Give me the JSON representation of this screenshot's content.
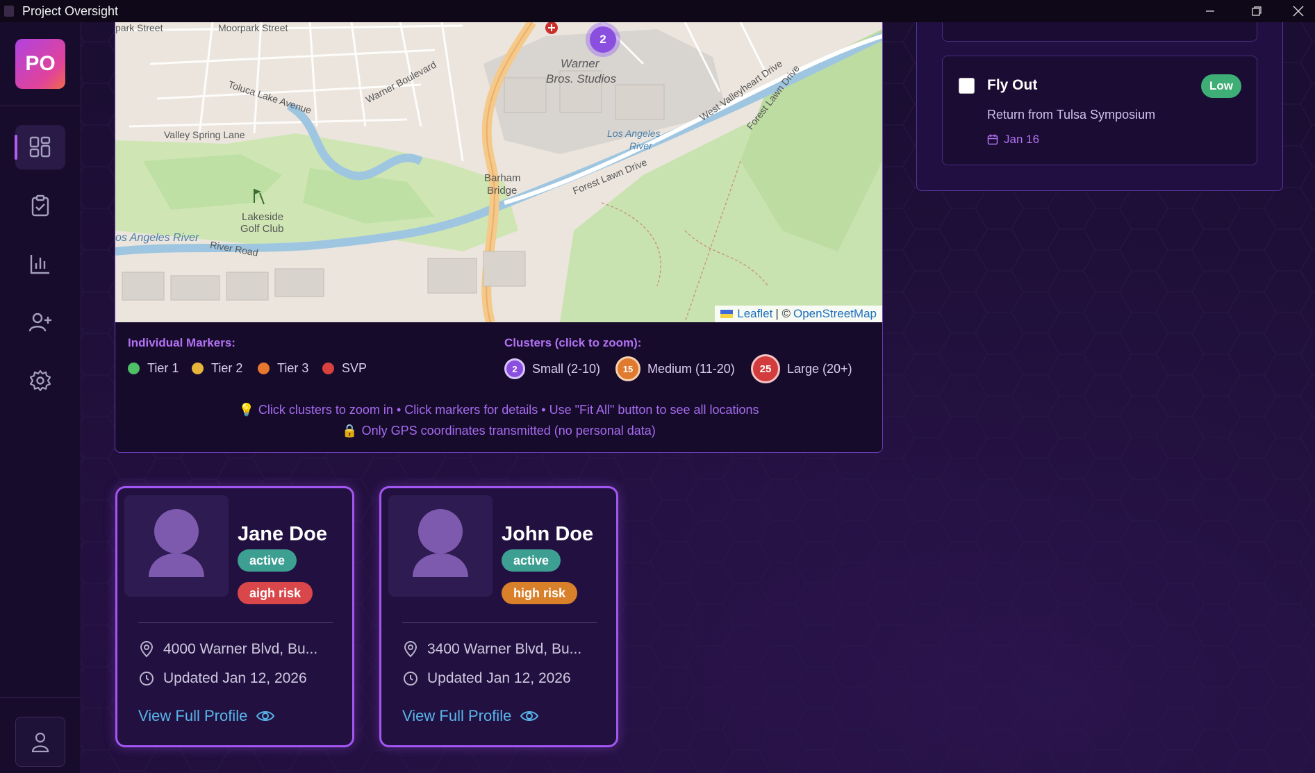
{
  "window": {
    "title": "Project Oversight",
    "controls": [
      "minimize",
      "restore",
      "close"
    ]
  },
  "sidebar": {
    "logo_text": "PO",
    "nav": [
      {
        "name": "dashboard",
        "icon": "dashboard-icon",
        "active": true
      },
      {
        "name": "tasks",
        "icon": "clipboard-check-icon",
        "active": false
      },
      {
        "name": "analytics",
        "icon": "bar-chart-icon",
        "active": false
      },
      {
        "name": "add-user",
        "icon": "user-plus-icon",
        "active": false
      },
      {
        "name": "settings",
        "icon": "gear-icon",
        "active": false
      }
    ],
    "profile_icon": "user-icon"
  },
  "map": {
    "labels": [
      {
        "text": "park Street"
      },
      {
        "text": "Moorpark Street"
      },
      {
        "text": "Toluca Lake Avenue"
      },
      {
        "text": "Warner Boulevard"
      },
      {
        "text": "Warner"
      },
      {
        "text": "Bros. Studios"
      },
      {
        "text": "Valley Spring Lane"
      },
      {
        "text": "Barham"
      },
      {
        "text": "Bridge"
      },
      {
        "text": "Lakeside"
      },
      {
        "text": "Golf Club"
      },
      {
        "text": "os Angeles River"
      },
      {
        "text": "River Road"
      },
      {
        "text": "Forest Lawn Drive"
      },
      {
        "text": "Los Angeles"
      },
      {
        "text": "River"
      },
      {
        "text": "West Valleyheart Drive"
      },
      {
        "text": "Forest Lawn Drive"
      }
    ],
    "cluster_marker": "2",
    "attribution": {
      "leaflet": "Leaflet",
      "separator": "| ©",
      "osm": "OpenStreetMap"
    }
  },
  "legend": {
    "individual_heading": "Individual Markers:",
    "tiers": [
      {
        "label": "Tier 1",
        "color": "#4fbf68"
      },
      {
        "label": "Tier 2",
        "color": "#e6b53a"
      },
      {
        "label": "Tier 3",
        "color": "#e8782e"
      },
      {
        "label": "SVP",
        "color": "#d9413f"
      }
    ],
    "clusters_heading": "Clusters (click to zoom):",
    "clusters": [
      {
        "count": "2",
        "label": "Small (2-10)",
        "color": "#8b4fe0"
      },
      {
        "count": "15",
        "label": "Medium (11-20)",
        "color": "#e07a2e"
      },
      {
        "count": "25",
        "label": "Large (20+)",
        "color": "#d33c3c"
      }
    ],
    "hint_line1": "Click clusters to zoom in • Click markers for details • Use \"Fit All\" button to see all locations",
    "hint_line2": "Only GPS coordinates transmitted (no personal data)"
  },
  "task": {
    "title": "Fly Out",
    "priority": "Low",
    "description": "Return from Tulsa Symposium",
    "date": "Jan 16"
  },
  "people": [
    {
      "name": "Jane Doe",
      "status": "active",
      "risk": "aigh risk",
      "risk_color": "#d9474a",
      "address": "4000 Warner Blvd, Bu...",
      "updated": "Updated Jan 12, 2026",
      "link": "View Full Profile"
    },
    {
      "name": "John Doe",
      "status": "active",
      "risk": "high risk",
      "risk_color": "#d8802a",
      "address": "3400 Warner Blvd, Bu...",
      "updated": "Updated Jan 12, 2026",
      "link": "View Full Profile"
    }
  ]
}
